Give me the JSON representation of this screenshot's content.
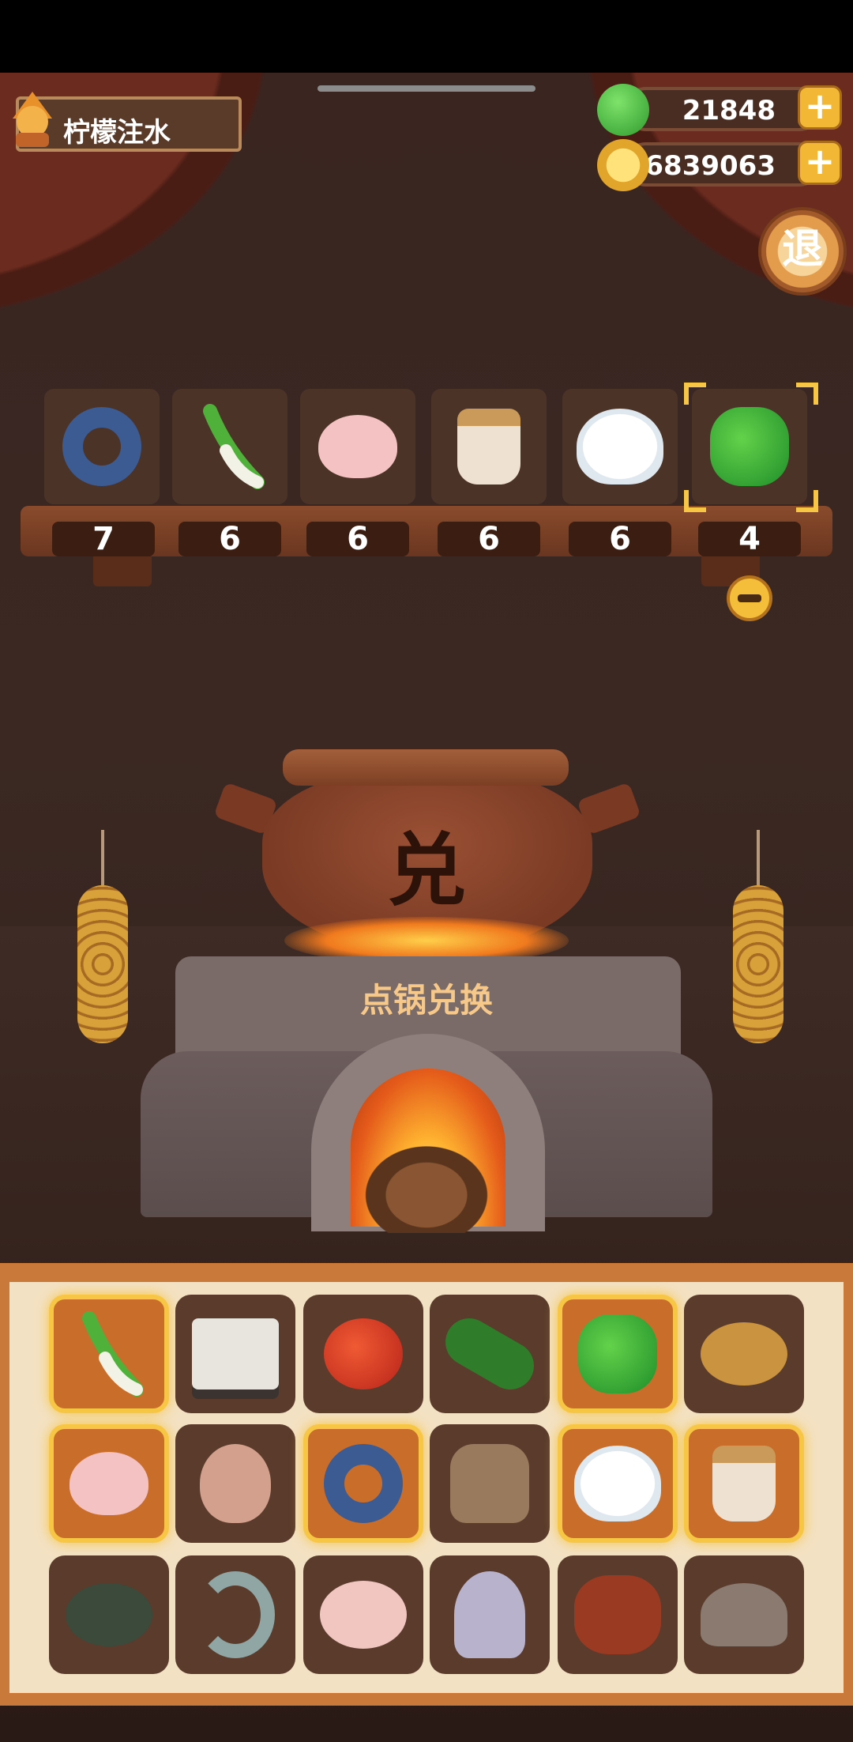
{
  "player": {
    "name": "柠檬注水"
  },
  "currency": {
    "gems": "21848",
    "coins": "6839063"
  },
  "exit_label": "退",
  "pot_glyph": "兑",
  "stove_label": "点锅兑换",
  "selected_ingredients": [
    {
      "icon": "fish-ring-icon",
      "count": "7"
    },
    {
      "icon": "leek-icon",
      "count": "6"
    },
    {
      "icon": "roast-bird-icon",
      "count": "6"
    },
    {
      "icon": "jar-icon",
      "count": "6"
    },
    {
      "icon": "rice-bowl-icon",
      "count": "6"
    },
    {
      "icon": "green-pepper-icon",
      "count": "4"
    }
  ],
  "inventory": [
    [
      {
        "icon": "leek-icon",
        "highlighted": true
      },
      {
        "icon": "tofu-icon",
        "highlighted": false
      },
      {
        "icon": "tomato-icon",
        "highlighted": false
      },
      {
        "icon": "cucumber-icon",
        "highlighted": false
      },
      {
        "icon": "green-pepper-icon",
        "highlighted": true
      },
      {
        "icon": "potato-icon",
        "highlighted": false
      }
    ],
    [
      {
        "icon": "roast-bird-icon",
        "highlighted": true
      },
      {
        "icon": "egg-icon",
        "highlighted": false
      },
      {
        "icon": "fish-ring-icon",
        "highlighted": true
      },
      {
        "icon": "sack-icon",
        "highlighted": false
      },
      {
        "icon": "rice-bowl-icon",
        "highlighted": true
      },
      {
        "icon": "jar-icon",
        "highlighted": true
      }
    ],
    [
      {
        "icon": "crab-icon",
        "highlighted": false
      },
      {
        "icon": "shrimp-icon",
        "highlighted": false
      },
      {
        "icon": "chicken-icon",
        "highlighted": false
      },
      {
        "icon": "squid-icon",
        "highlighted": false
      },
      {
        "icon": "meat-icon",
        "highlighted": false
      },
      {
        "icon": "clam-icon",
        "highlighted": false
      }
    ]
  ],
  "colors": {
    "highlight": "#f6c644",
    "panel": "#f3e1c3",
    "accent": "#f2b835"
  }
}
